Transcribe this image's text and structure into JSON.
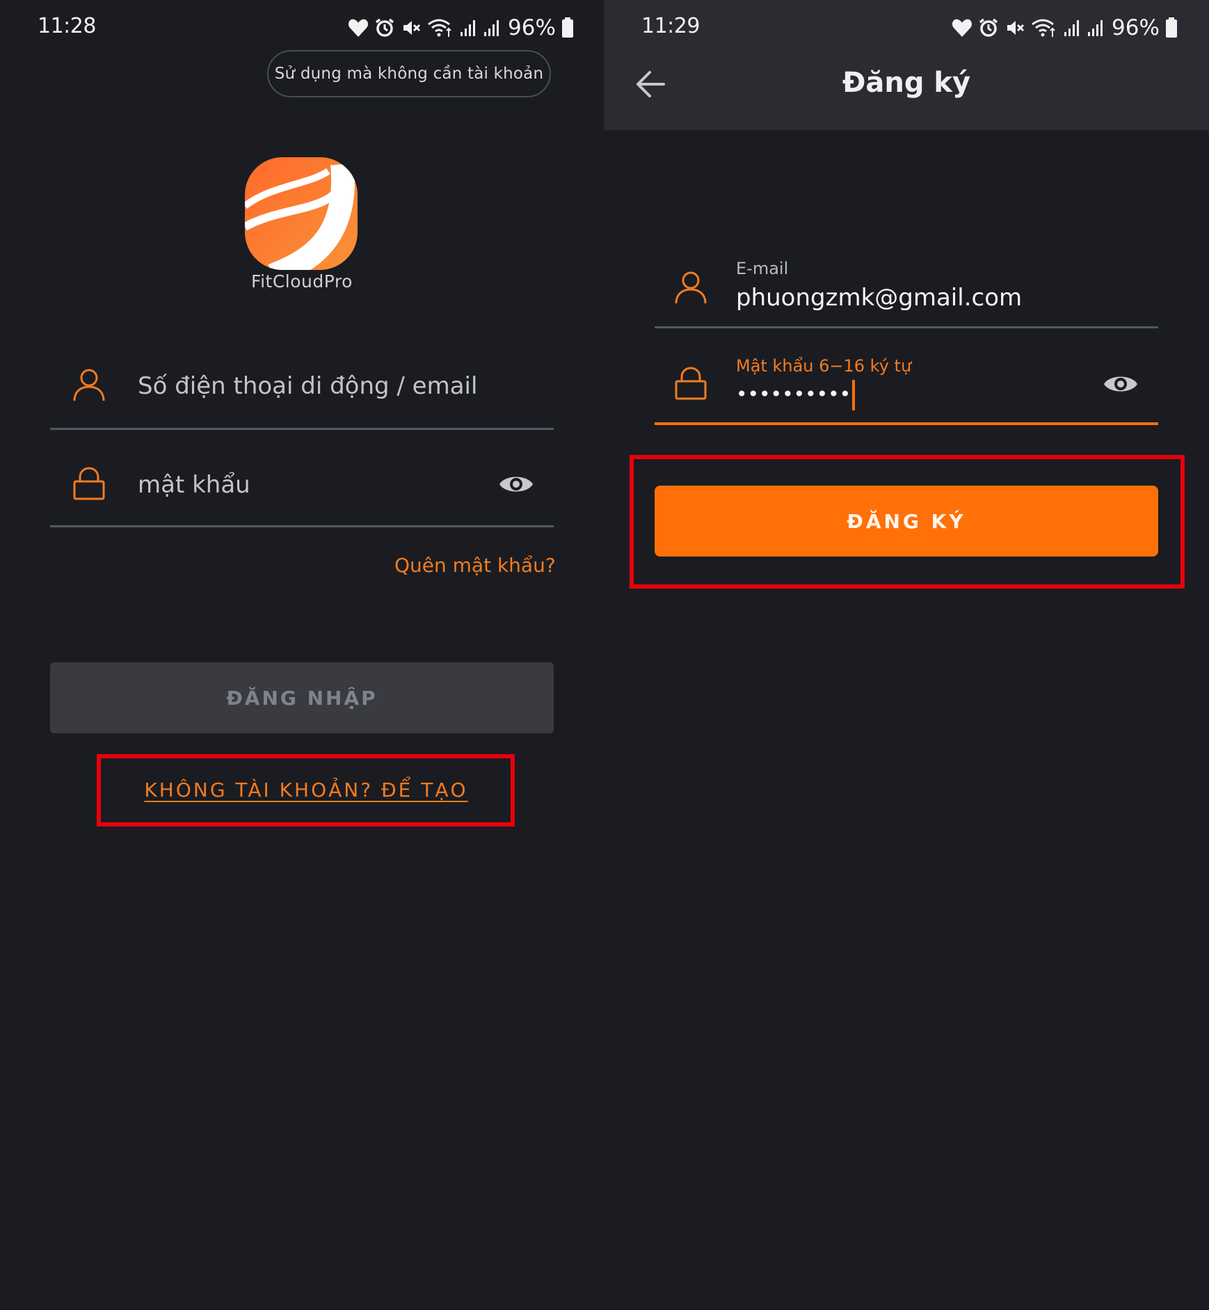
{
  "colors": {
    "background": "#1a1c21",
    "app_bar": "#2a2c32",
    "accent": "#ff7009",
    "link": "#f47b20",
    "highlight": "#e8000b",
    "disabled_button": "#393b41"
  },
  "login_screen": {
    "status_bar": {
      "time": "11:28",
      "battery": "96%",
      "icons": [
        "heart-icon",
        "alarm-icon",
        "mute-icon",
        "wifi-icon",
        "signal-icon",
        "signal-icon",
        "battery-icon"
      ]
    },
    "guest_button": "Sử dụng mà không cần tài khoản",
    "app_name": "FitCloudPro",
    "account_field": {
      "placeholder": "Số điện thoại di động / email",
      "icon": "user-icon"
    },
    "password_field": {
      "placeholder": "mật khẩu",
      "icon": "lock-icon",
      "toggle_icon": "eye-icon"
    },
    "forgot_password": "Quên mật khẩu?",
    "login_button": "ĐĂNG NHẬP",
    "create_account_link": "KHÔNG TÀI KHOẢN? ĐỂ TẠO"
  },
  "register_screen": {
    "status_bar": {
      "time": "11:29",
      "battery": "96%",
      "icons": [
        "heart-icon",
        "alarm-icon",
        "mute-icon",
        "wifi-icon",
        "signal-icon",
        "signal-icon",
        "battery-icon"
      ]
    },
    "title": "Đăng ký",
    "back_icon": "back-arrow-icon",
    "email_field": {
      "label": "E-mail",
      "value": "phuongzmk@gmail.com",
      "icon": "user-icon"
    },
    "password_field": {
      "label": "Mật khẩu 6−16 ký tự",
      "value": "••••••••••",
      "icon": "lock-icon",
      "toggle_icon": "eye-icon"
    },
    "register_button": "ĐĂNG KÝ"
  }
}
